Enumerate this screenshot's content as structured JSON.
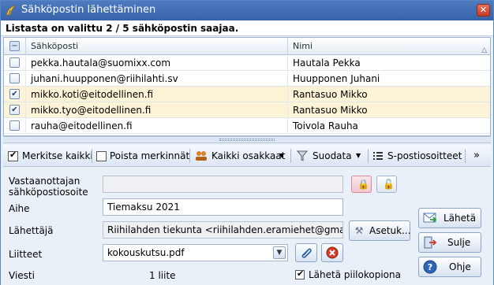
{
  "window": {
    "title": "Sähköpostin lähettäminen",
    "close_glyph": "✕"
  },
  "info": {
    "text": "Listasta on valittu 2 / 5 sähköpostin saajaa."
  },
  "grid": {
    "columns": [
      "Sähköposti",
      "Nimi"
    ],
    "rows": [
      {
        "email": "pekka.hautala@suomixx.com",
        "name": "Hautala Pekka",
        "checked": false
      },
      {
        "email": "juhani.huupponen@riihilahti.sv",
        "name": "Huupponen Juhani",
        "checked": false
      },
      {
        "email": "mikko.koti@eitodellinen.fi",
        "name": "Rantasuo Mikko",
        "checked": true
      },
      {
        "email": "mikko.tyo@eitodellinen.fi",
        "name": "Rantasuo Mikko",
        "checked": true
      },
      {
        "email": "rauha@eitodellinen.fi",
        "name": "Toivola Rauha",
        "checked": false
      }
    ],
    "sort_glyph": "△"
  },
  "toolbar": {
    "select_all": "Merkitse kaikki",
    "clear_all": "Poista merkinnät",
    "all_members": "Kaikki osakkaat",
    "filter": "Suodata",
    "addresses": "S-postiosoitteet",
    "more_glyph": "»"
  },
  "form": {
    "recipient_label_1": "Vastaanottajan",
    "recipient_label_2": "sähköpostiosoite",
    "recipient_value": "",
    "subject_label": "Aihe",
    "subject_value": "Tiemaksu 2021",
    "sender_label": "Lähettäjä",
    "sender_value": "Riihilahden tiekunta <riihilahden.eramiehet@gmail.c",
    "settings_button": "Asetuk...",
    "attachments_label": "Liitteet",
    "attachment_value": "kokouskutsu.pdf",
    "message_label": "Viesti",
    "attachment_count": "1 liite",
    "bcc_label": "Lähetä piilokopiona",
    "bcc_checked": true
  },
  "actions": {
    "send": "Lähetä",
    "close": "Sulje",
    "help": "Ohje"
  },
  "colors": {
    "title_bar": "#3f6db4",
    "selected_row": "#fdf3d6",
    "form_bg": "#eaf0f8"
  }
}
